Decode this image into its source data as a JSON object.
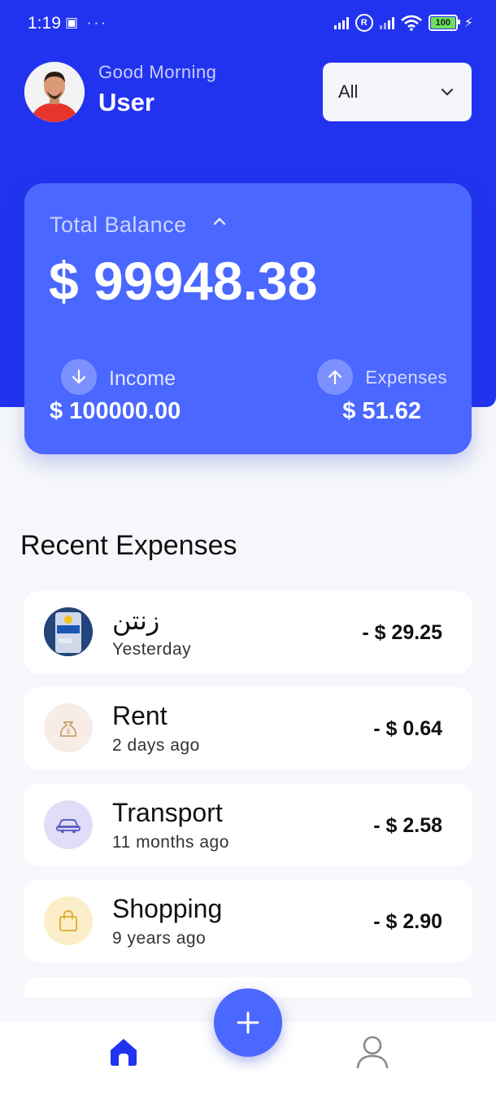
{
  "status": {
    "time": "1:19",
    "left_icons": "▣ ···",
    "battery": "100"
  },
  "header": {
    "greeting": "Good Morning",
    "username": "User",
    "filter": {
      "selected": "All"
    }
  },
  "balance": {
    "label": "Total Balance",
    "total": "$ 99948.38",
    "income_label": "Income",
    "income_value": "$ 100000.00",
    "expenses_label": "Expenses",
    "expenses_value": "$ 51.62"
  },
  "recent": {
    "title": "Recent Expenses",
    "items": [
      {
        "title": "زنتن",
        "time": "Yesterday",
        "amount": "- $ 29.25",
        "icon": "product-photo"
      },
      {
        "title": "Rent",
        "time": "2 days ago",
        "amount": "- $ 0.64",
        "icon": "money-bag-icon"
      },
      {
        "title": "Transport",
        "time": "11 months ago",
        "amount": "- $ 2.58",
        "icon": "car-icon"
      },
      {
        "title": "Shopping",
        "time": "9 years ago",
        "amount": "- $ 2.90",
        "icon": "shopping-bag-icon"
      }
    ]
  },
  "colors": {
    "header_bg": "#2233f0",
    "card_bg": "#4a67ff",
    "accent": "#4a67ff"
  },
  "nav": {
    "home_icon": "home-icon",
    "add_icon": "plus-icon",
    "profile_icon": "user-icon"
  }
}
